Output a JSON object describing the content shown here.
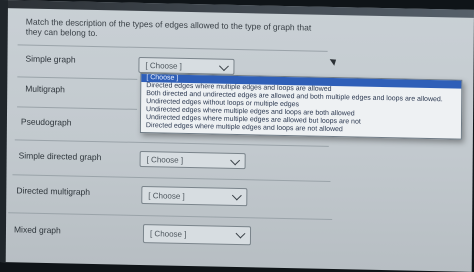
{
  "question": "Match the description of the types of edges allowed to the type of graph that they can belong to.",
  "rows": [
    {
      "label": "Simple graph",
      "value": "[ Choose ]"
    },
    {
      "label": "Multigraph",
      "value": ""
    },
    {
      "label": "Pseudograph",
      "value": ""
    },
    {
      "label": "Simple directed graph",
      "value": "[ Choose ]"
    },
    {
      "label": "Directed multigraph",
      "value": "[ Choose ]"
    },
    {
      "label": "Mixed graph",
      "value": "[ Choose ]"
    }
  ],
  "dropdown": {
    "options": [
      "[ Choose ]",
      "Directed edges where multiple edges and loops are allowed",
      "Both directed and undirected edges are allowed and both multiple edges and loops are allowed.",
      "Undirected edges without loops or multiple edges",
      "Undirected edges where multiple edges and loops are both allowed",
      "Undirected edges where multiple edges are allowed but loops are not",
      "Directed edges where multiple edges and loops are not allowed"
    ]
  }
}
